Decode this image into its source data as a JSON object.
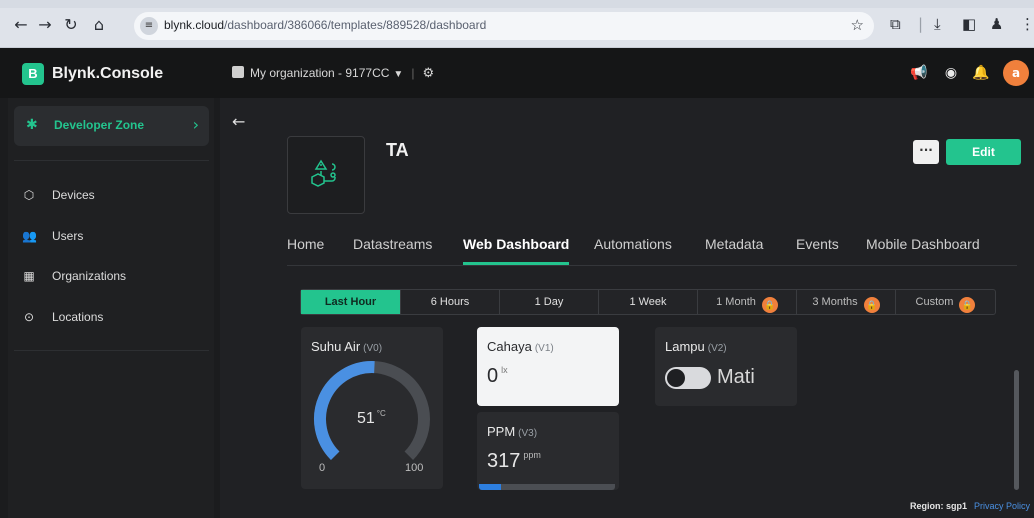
{
  "browser": {
    "url_host": "blynk.cloud",
    "url_path": "/dashboard/386066/templates/889528/dashboard"
  },
  "app": {
    "brand_badge": "B",
    "brand_name": "Blynk.Console",
    "org_name": "My organization - 9177CC",
    "avatar_initial": "a"
  },
  "sidebar": {
    "dev_zone": "Developer Zone",
    "items": [
      {
        "label": "Devices",
        "icon": "cube-icon"
      },
      {
        "label": "Users",
        "icon": "users-icon"
      },
      {
        "label": "Organizations",
        "icon": "building-icon"
      },
      {
        "label": "Locations",
        "icon": "pin-icon"
      }
    ]
  },
  "template": {
    "title": "TA",
    "more_label": "···",
    "edit_label": "Edit"
  },
  "tabs": [
    {
      "label": "Home",
      "active": false
    },
    {
      "label": "Datastreams",
      "active": false
    },
    {
      "label": "Web Dashboard",
      "active": true
    },
    {
      "label": "Automations",
      "active": false
    },
    {
      "label": "Metadata",
      "active": false
    },
    {
      "label": "Events",
      "active": false
    },
    {
      "label": "Mobile Dashboard",
      "active": false
    }
  ],
  "time_ranges": [
    {
      "label": "Last Hour",
      "active": true,
      "locked": false
    },
    {
      "label": "6 Hours",
      "active": false,
      "locked": false
    },
    {
      "label": "1 Day",
      "active": false,
      "locked": false
    },
    {
      "label": "1 Week",
      "active": false,
      "locked": false
    },
    {
      "label": "1 Month",
      "active": false,
      "locked": true
    },
    {
      "label": "3 Months",
      "active": false,
      "locked": true
    },
    {
      "label": "Custom",
      "active": false,
      "locked": true
    }
  ],
  "widgets": {
    "suhu": {
      "title": "Suhu Air",
      "pin": "(V0)",
      "value": "51",
      "unit": "°C",
      "min": "0",
      "max": "100",
      "level": 0.51
    },
    "cahaya": {
      "title": "Cahaya",
      "pin": "(V1)",
      "value": "0",
      "unit": "lx"
    },
    "lampu": {
      "title": "Lampu",
      "pin": "(V2)",
      "state_label": "Mati"
    },
    "ppm": {
      "title": "PPM",
      "pin": "(V3)",
      "value": "317",
      "unit": "ppm",
      "level": 0.16
    }
  },
  "footer": {
    "region": "Region: sgp1",
    "privacy": "Privacy Policy"
  },
  "colors": {
    "accent": "#23c48e",
    "gauge": "#4a90e2",
    "lock": "#f0803c"
  }
}
